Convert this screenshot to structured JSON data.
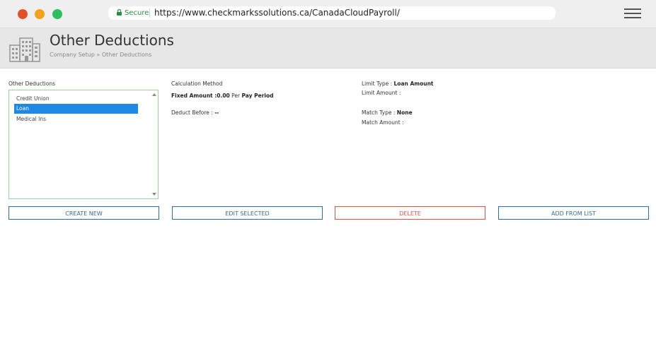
{
  "browser": {
    "secure_label": "Secure",
    "url": "https://www.checkmarkssolutions.ca/CanadaCloudPayroll/"
  },
  "header": {
    "title": "Other Deductions",
    "breadcrumb": "Company Setup » Other Deductions"
  },
  "deductions": {
    "label": "Other Deductions",
    "items": [
      "Credit Union",
      "Loan",
      "Medical Ins"
    ],
    "selected": "Loan"
  },
  "details": {
    "calculation_method_label": "Calculation Method",
    "fixed_amount_label": "Fixed Amount :",
    "fixed_amount_value": "0.00",
    "per_label": "Per",
    "pay_period_label": "Pay Period",
    "deduct_before_label": "Deduct Before :",
    "deduct_before_value": "--",
    "limit_type_label": "Limit Type :",
    "limit_type_value": "Loan Amount",
    "limit_amount_label": "Limit Amount :",
    "match_type_label": "Match Type :",
    "match_type_value": "None",
    "match_amount_label": "Match Amount :"
  },
  "buttons": {
    "create_new": "CREATE NEW",
    "edit_selected": "EDIT SELECTED",
    "delete": "DELETE",
    "add_from_list": "ADD FROM LIST"
  },
  "colors": {
    "primary": "#2f6e92",
    "danger": "#d9534f",
    "selected": "#1e88e5",
    "list_border": "#9fd09f"
  }
}
